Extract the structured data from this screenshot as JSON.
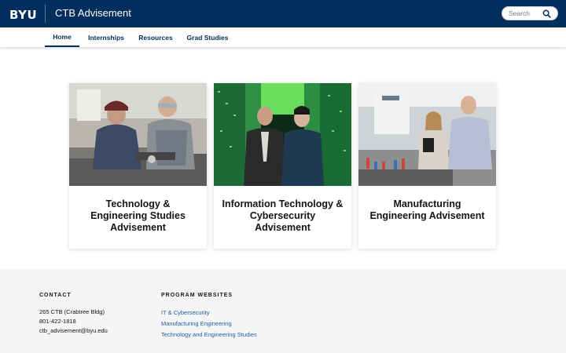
{
  "header": {
    "logo_text": "BYU",
    "site_title": "CTB Advisement",
    "search_placeholder": "Search",
    "bg_color": "#002e5d"
  },
  "nav": {
    "items": [
      {
        "label": "Home",
        "active": true
      },
      {
        "label": "Internships",
        "active": false
      },
      {
        "label": "Resources",
        "active": false
      },
      {
        "label": "Grad Studies",
        "active": false
      }
    ]
  },
  "cards": [
    {
      "title": "Technology & Engineering Studies Advisement"
    },
    {
      "title": "Information Technology & Cybersecurity Advisement"
    },
    {
      "title": "Manufacturing Engineering Advisement"
    }
  ],
  "footer": {
    "contact": {
      "heading": "CONTACT",
      "address": "265 CTB (Crabtree Bldg)",
      "phone": "801-422-1818",
      "email": "ctb_advisement@byu.edu"
    },
    "programs": {
      "heading": "PROGRAM WEBSITES",
      "links": [
        "IT & Cybersecurity",
        "Manufacturing Engineering",
        "Technology and Engineering Studies"
      ]
    }
  }
}
